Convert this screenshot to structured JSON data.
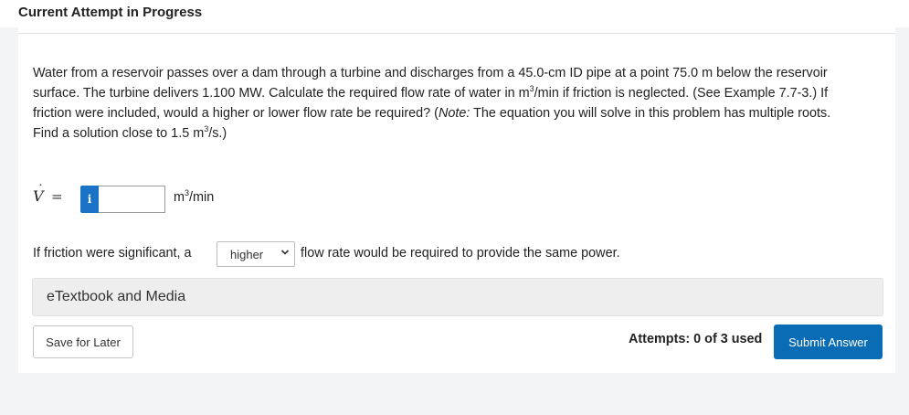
{
  "header": {
    "title": "Current Attempt in Progress"
  },
  "question": {
    "text_1": "Water from a reservoir passes over a dam through a turbine and discharges from a 45.0-cm ID pipe at a point 75.0 m below the reservoir surface. The turbine delivers 1.100 MW. Calculate the required flow rate of water in m",
    "sup_1": "3",
    "text_2": "/min if friction is neglected. (See Example 7.7-3.) If friction were included, would a higher or lower flow rate be required? (",
    "note_label": "Note:",
    "text_3": " The equation you will solve in this problem has multiple roots. Find a solution close to 1.5 m",
    "sup_2": "3",
    "text_4": "/s.)"
  },
  "answer": {
    "symbol": "V",
    "dot": "˙",
    "equals": "=",
    "info_icon_glyph": "i",
    "value": "",
    "unit_base": "m",
    "unit_sup": "3",
    "unit_rest": "/min"
  },
  "friction": {
    "prefix": "If friction were significant, a",
    "selected": "higher",
    "suffix": "flow rate would be required to provide the same power."
  },
  "etextbook": {
    "label": "eTextbook and Media"
  },
  "footer": {
    "save_label": "Save for Later",
    "attempts_text": "Attempts: 0 of 3 used",
    "submit_label": "Submit Answer"
  },
  "colors": {
    "accent": "#0a6cb4",
    "info": "#1a73c7"
  }
}
